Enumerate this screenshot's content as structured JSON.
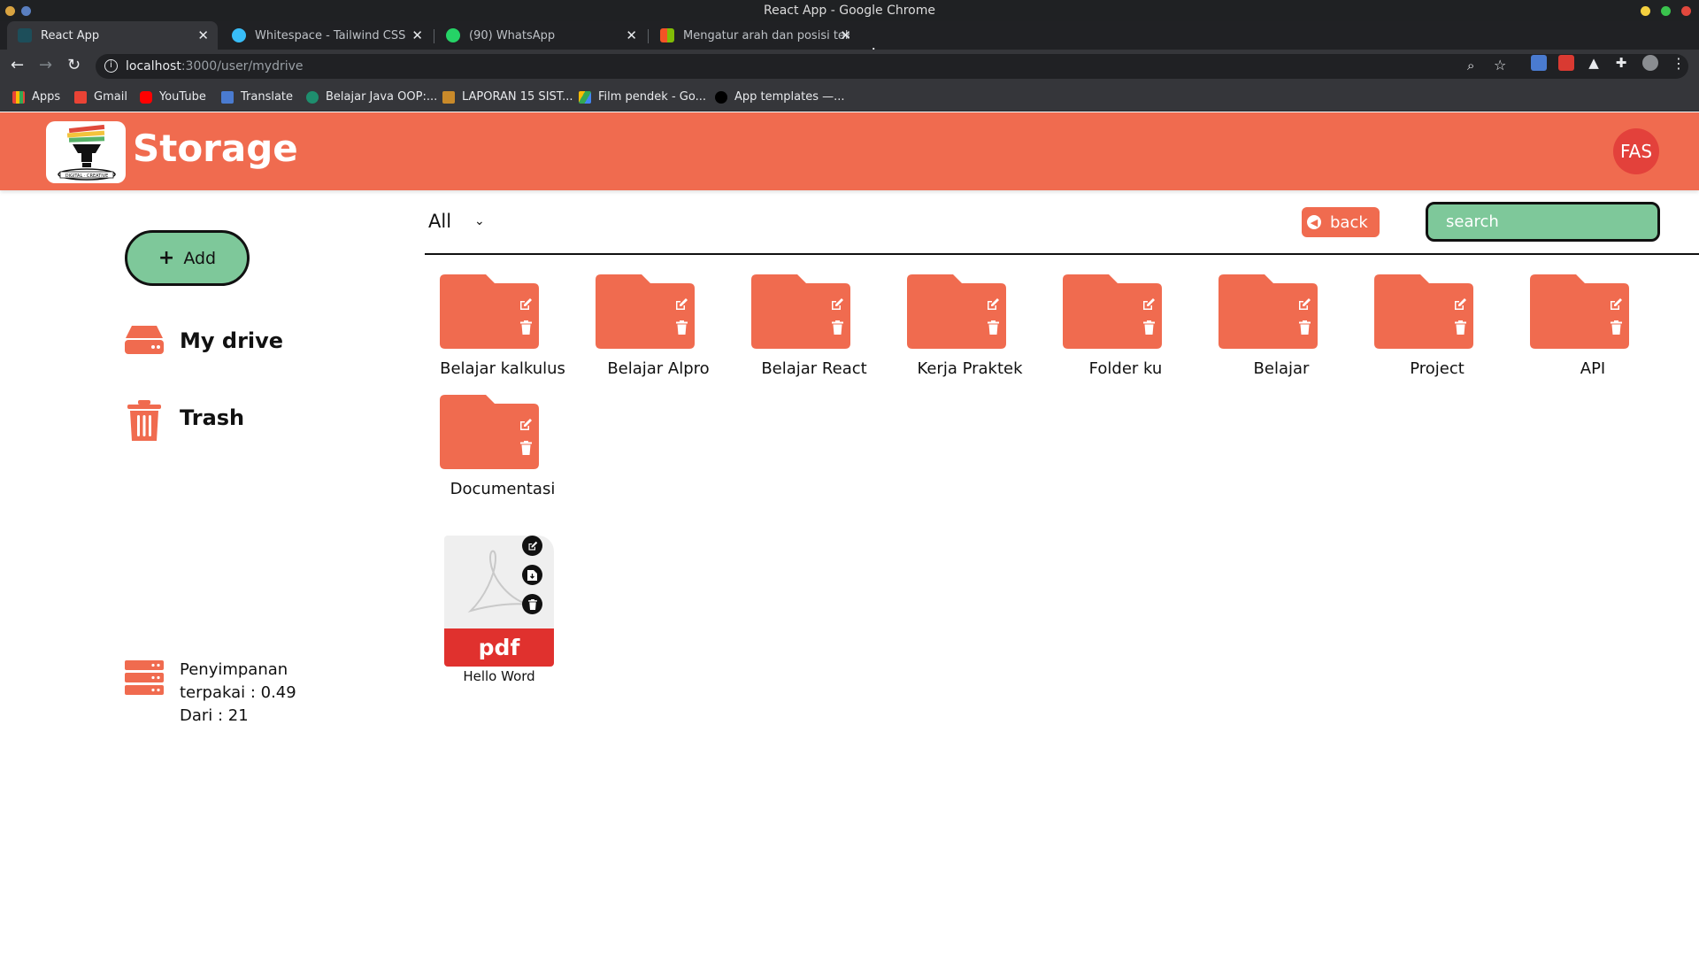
{
  "window": {
    "title": "React App - Google Chrome"
  },
  "tabs": [
    {
      "label": "React App",
      "active": true
    },
    {
      "label": "Whitespace - Tailwind CSS",
      "active": false
    },
    {
      "label": "(90) WhatsApp",
      "active": false
    },
    {
      "label": "Mengatur arah dan posisi tek",
      "active": false
    }
  ],
  "address_bar": {
    "host": "localhost",
    "path": ":3000/user/mydrive"
  },
  "bookmarks": [
    {
      "label": "Apps"
    },
    {
      "label": "Gmail"
    },
    {
      "label": "YouTube"
    },
    {
      "label": "Translate"
    },
    {
      "label": "Belajar Java OOP:..."
    },
    {
      "label": "LAPORAN 15 SIST..."
    },
    {
      "label": "Film pendek - Go..."
    },
    {
      "label": "App templates —..."
    }
  ],
  "header": {
    "title": "Storage",
    "avatar_initials": "FAS",
    "color": "#f06b4f"
  },
  "sidebar": {
    "add_label": "Add",
    "items": [
      {
        "label": "My drive",
        "icon": "drive-icon"
      },
      {
        "label": "Trash",
        "icon": "trash-icon"
      }
    ],
    "storage": {
      "line1": "Penyimpanan",
      "line2": "terpakai : 0.49",
      "line3": "Dari : 21"
    }
  },
  "toolbar": {
    "filter_selected": "All",
    "back_label": "back",
    "search_placeholder": "search"
  },
  "folders": [
    {
      "name": "Belajar kalkulus"
    },
    {
      "name": "Belajar Alpro"
    },
    {
      "name": "Belajar React"
    },
    {
      "name": "Kerja Praktek"
    },
    {
      "name": "Folder ku"
    },
    {
      "name": "Belajar"
    },
    {
      "name": "Project"
    },
    {
      "name": "API"
    },
    {
      "name": "Documentasi"
    }
  ],
  "files": [
    {
      "name": "Hello Word",
      "type_label": "pdf"
    }
  ]
}
